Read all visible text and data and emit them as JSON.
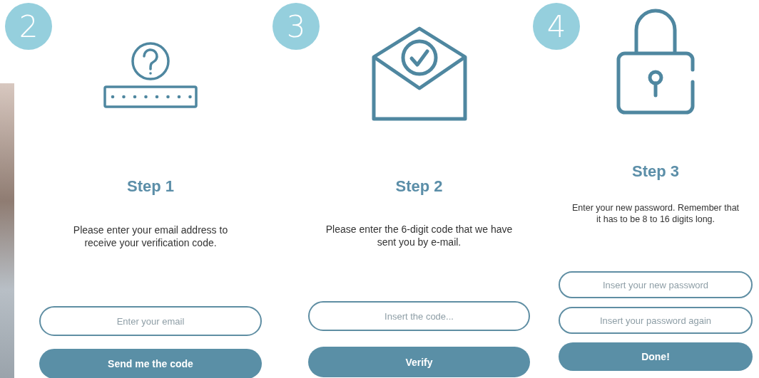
{
  "screens": [
    {
      "badge": "2",
      "kind": "password",
      "title": "Step 1",
      "instructions": "Please enter your email address to receive your verification code.",
      "fields": [
        {
          "placeholder": "Enter your email"
        }
      ],
      "button": "Send me the code"
    },
    {
      "badge": "3",
      "kind": "envelope",
      "title": "Step 2",
      "instructions": "Please enter the 6-digit code that we have sent you by e-mail.",
      "fields": [
        {
          "placeholder": "Insert the code..."
        }
      ],
      "button": "Verify"
    },
    {
      "badge": "4",
      "kind": "lock",
      "title": "Step 3",
      "instructions": "Enter your new password. Remember that it has to be 8 to 16 digits long.",
      "fields": [
        {
          "placeholder": "Insert your new password"
        },
        {
          "placeholder": "Insert your password again"
        }
      ],
      "button": "Done!"
    }
  ]
}
